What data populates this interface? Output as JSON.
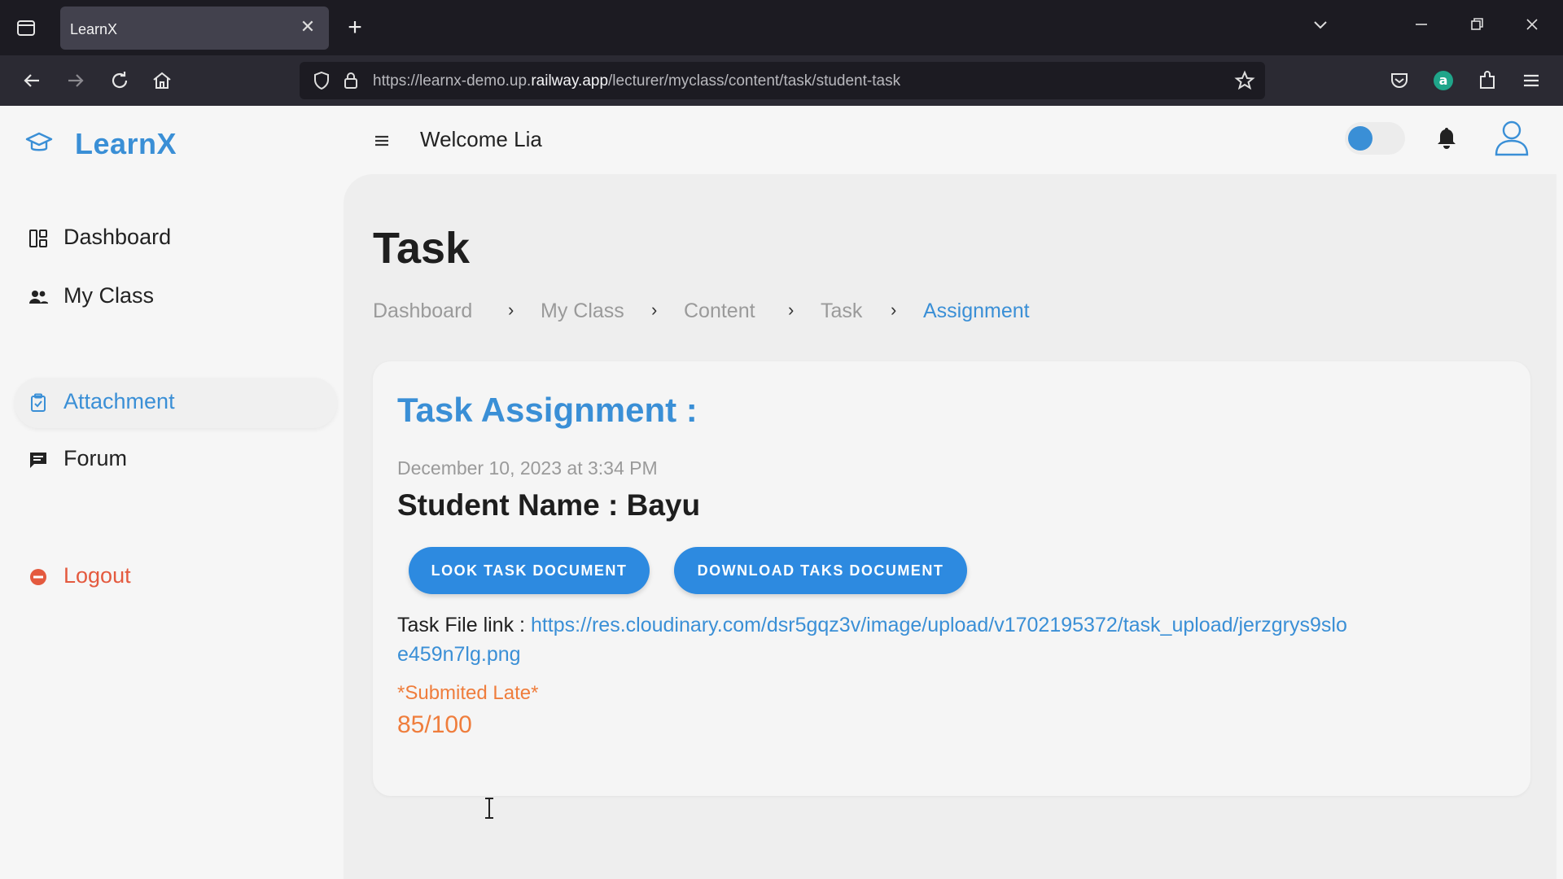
{
  "browser": {
    "tab_title": "LearnX",
    "tab_close": "✕",
    "new_tab": "+",
    "url_plain_1": "https://learnx-demo.up.",
    "url_domain": "railway.app",
    "url_plain_2": "/lecturer/myclass/content/task/student-task"
  },
  "brand": {
    "name": "LearnX"
  },
  "sidebar": {
    "items": [
      {
        "label": "Dashboard",
        "icon": "dashboard-icon"
      },
      {
        "label": "My Class",
        "icon": "users-icon"
      },
      {
        "label": "Attachment",
        "icon": "clipboard-icon",
        "active": true
      },
      {
        "label": "Forum",
        "icon": "chat-icon"
      }
    ],
    "logout": {
      "label": "Logout",
      "icon": "logout-icon"
    }
  },
  "topbar": {
    "welcome": "Welcome Lia"
  },
  "page": {
    "title": "Task",
    "breadcrumb": [
      "Dashboard",
      "My Class",
      "Content",
      "Task",
      "Assignment"
    ],
    "separator": "›"
  },
  "card": {
    "title": "Task Assignment :",
    "date": "December 10, 2023 at 3:34 PM",
    "student": "Student Name : Bayu",
    "buttons": {
      "look": "LOOK TASK DOCUMENT",
      "download": "DOWNLOAD TAKS DOCUMENT"
    },
    "file_label": "Task File link :",
    "file_link": "https://res.cloudinary.com/dsr5gqz3v/image/upload/v1702195372/task_upload/jerzgrys9sloe459n7lg.png",
    "status": "*Submited Late*",
    "score": "85/100"
  },
  "colors": {
    "accent": "#3a8fd6",
    "button": "#2d8ae0",
    "warning": "#ef7d3c",
    "logout": "#e45a3f"
  }
}
